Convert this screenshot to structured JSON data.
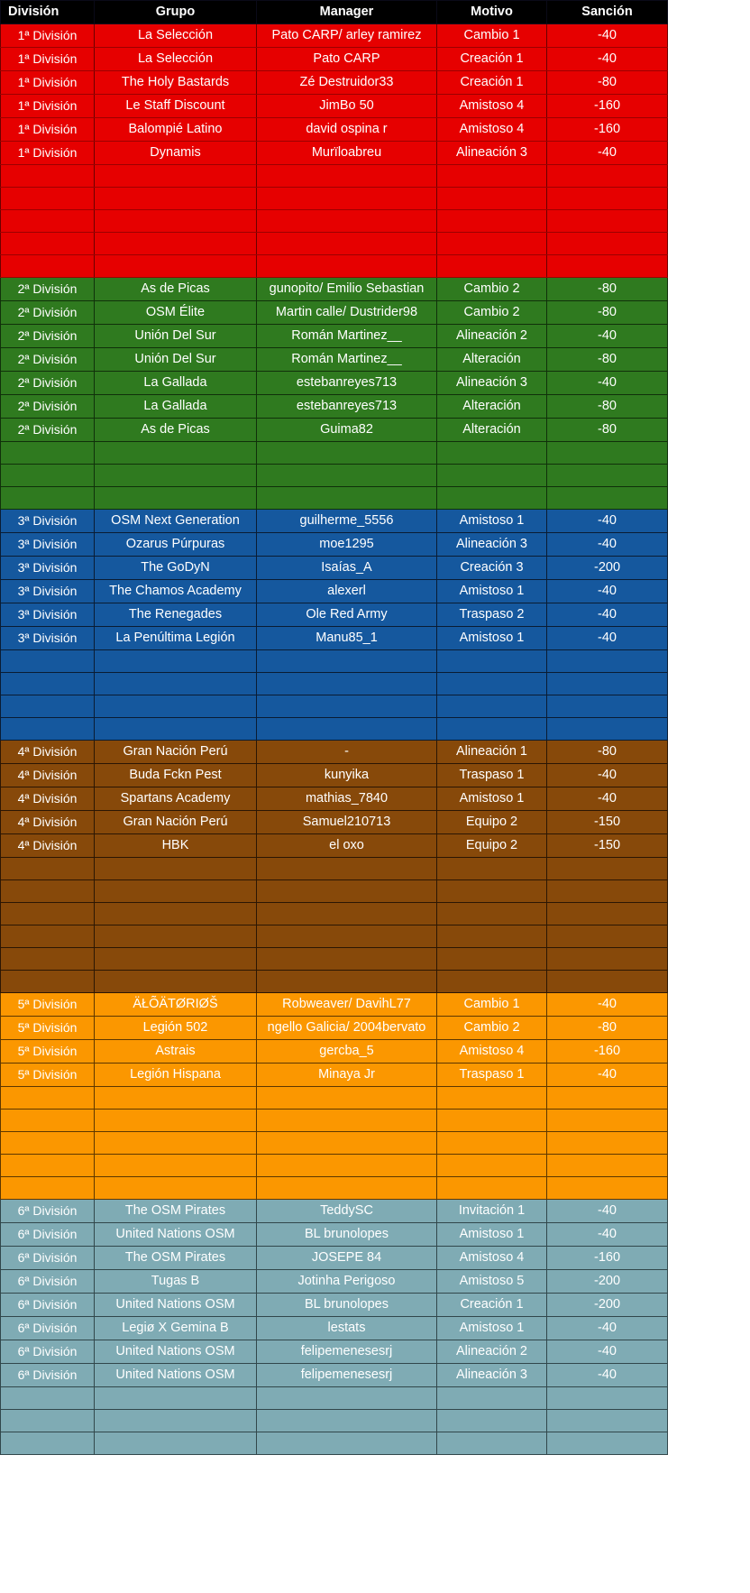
{
  "table": {
    "headers": {
      "division": "División",
      "grupo": "Grupo",
      "manager": "Manager",
      "motivo": "Motivo",
      "sancion": "Sanción"
    },
    "colors": {
      "header_bg": "#000000",
      "header_text": "#ffffff",
      "div1": "#e60000",
      "div2": "#2f7a1f",
      "div3": "#15589e",
      "div4": "#87490a",
      "div5": "#fb9700",
      "div6": "#7fabb4",
      "cell_text": "#ffffff",
      "gridline": "#0a0a18"
    },
    "sections": [
      {
        "key": "div1",
        "division": "1ª División",
        "rows": [
          {
            "division": "1ª División",
            "grupo": "La Selección",
            "manager": "Pato CARP/ arley ramirez",
            "motivo": "Cambio 1",
            "sancion": "-40"
          },
          {
            "division": "1ª División",
            "grupo": "La Selección",
            "manager": "Pato CARP",
            "motivo": "Creación 1",
            "sancion": "-40"
          },
          {
            "division": "1ª División",
            "grupo": "The Holy Bastards",
            "manager": "Zé Destruidor33",
            "motivo": "Creación 1",
            "sancion": "-80"
          },
          {
            "division": "1ª División",
            "grupo": "Le Staff Discount",
            "manager": "JimBo 50",
            "motivo": "Amistoso 4",
            "sancion": "-160"
          },
          {
            "division": "1ª División",
            "grupo": "Balompié Latino",
            "manager": "david ospina r",
            "motivo": "Amistoso 4",
            "sancion": "-160"
          },
          {
            "division": "1ª División",
            "grupo": "Dynamis",
            "manager": "Murïloabreu",
            "motivo": "Alineación 3",
            "sancion": "-40"
          },
          {
            "division": "",
            "grupo": "",
            "manager": "",
            "motivo": "",
            "sancion": ""
          },
          {
            "division": "",
            "grupo": "",
            "manager": "",
            "motivo": "",
            "sancion": ""
          },
          {
            "division": "",
            "grupo": "",
            "manager": "",
            "motivo": "",
            "sancion": ""
          },
          {
            "division": "",
            "grupo": "",
            "manager": "",
            "motivo": "",
            "sancion": ""
          },
          {
            "division": "",
            "grupo": "",
            "manager": "",
            "motivo": "",
            "sancion": ""
          }
        ]
      },
      {
        "key": "div2",
        "division": "2ª División",
        "rows": [
          {
            "division": "2ª División",
            "grupo": "As de Picas",
            "manager": "gunopito/ Emilio Sebastian",
            "motivo": "Cambio 2",
            "sancion": "-80"
          },
          {
            "division": "2ª División",
            "grupo": "OSM Élite",
            "manager": "Martin calle/ Dustrider98",
            "motivo": "Cambio 2",
            "sancion": "-80"
          },
          {
            "division": "2ª División",
            "grupo": "Unión Del Sur",
            "manager": "Román Martinez__",
            "motivo": "Alineación 2",
            "sancion": "-40"
          },
          {
            "division": "2ª División",
            "grupo": "Unión Del Sur",
            "manager": "Román Martinez__",
            "motivo": "Alteración",
            "sancion": "-80"
          },
          {
            "division": "2ª División",
            "grupo": "La Gallada",
            "manager": "estebanreyes713",
            "motivo": "Alineación 3",
            "sancion": "-40"
          },
          {
            "division": "2ª División",
            "grupo": "La Gallada",
            "manager": "estebanreyes713",
            "motivo": "Alteración",
            "sancion": "-80"
          },
          {
            "division": "2ª División",
            "grupo": "As de Picas",
            "manager": "Guima82",
            "motivo": "Alteración",
            "sancion": "-80"
          },
          {
            "division": "",
            "grupo": "",
            "manager": "",
            "motivo": "",
            "sancion": ""
          },
          {
            "division": "",
            "grupo": "",
            "manager": "",
            "motivo": "",
            "sancion": ""
          },
          {
            "division": "",
            "grupo": "",
            "manager": "",
            "motivo": "",
            "sancion": ""
          }
        ]
      },
      {
        "key": "div3",
        "division": "3ª División",
        "rows": [
          {
            "division": "3ª División",
            "grupo": "OSM Next Generation",
            "manager": "guilherme_5556",
            "motivo": "Amistoso 1",
            "sancion": "-40"
          },
          {
            "division": "3ª División",
            "grupo": "Ozarus Púrpuras",
            "manager": "moe1295",
            "motivo": "Alineación 3",
            "sancion": "-40"
          },
          {
            "division": "3ª División",
            "grupo": "The GoDyN",
            "manager": "Isaías_A",
            "motivo": "Creación 3",
            "sancion": "-200"
          },
          {
            "division": "3ª División",
            "grupo": "The Chamos Academy",
            "manager": "alexerl",
            "motivo": "Amistoso 1",
            "sancion": "-40"
          },
          {
            "division": "3ª División",
            "grupo": "The Renegades",
            "manager": "Ole Red Army",
            "motivo": "Traspaso 2",
            "sancion": "-40"
          },
          {
            "division": "3ª División",
            "grupo": "La Penúltima Legión",
            "manager": "Manu85_1",
            "motivo": "Amistoso 1",
            "sancion": "-40"
          },
          {
            "division": "",
            "grupo": "",
            "manager": "",
            "motivo": "",
            "sancion": ""
          },
          {
            "division": "",
            "grupo": "",
            "manager": "",
            "motivo": "",
            "sancion": ""
          },
          {
            "division": "",
            "grupo": "",
            "manager": "",
            "motivo": "",
            "sancion": ""
          },
          {
            "division": "",
            "grupo": "",
            "manager": "",
            "motivo": "",
            "sancion": ""
          }
        ]
      },
      {
        "key": "div4",
        "division": "4ª División",
        "rows": [
          {
            "division": "4ª División",
            "grupo": "Gran Nación Perú",
            "manager": "-",
            "motivo": "Alineación 1",
            "sancion": "-80"
          },
          {
            "division": "4ª División",
            "grupo": "Buda Fckn Pest",
            "manager": "kunyika",
            "motivo": "Traspaso 1",
            "sancion": "-40"
          },
          {
            "division": "4ª División",
            "grupo": "Spartans Academy",
            "manager": "mathias_7840",
            "motivo": "Amistoso 1",
            "sancion": "-40"
          },
          {
            "division": "4ª División",
            "grupo": "Gran Nación Perú",
            "manager": "Samuel210713",
            "motivo": "Equipo 2",
            "sancion": "-150"
          },
          {
            "division": "4ª División",
            "grupo": "HBK",
            "manager": "el oxo",
            "motivo": "Equipo 2",
            "sancion": "-150"
          },
          {
            "division": "",
            "grupo": "",
            "manager": "",
            "motivo": "",
            "sancion": ""
          },
          {
            "division": "",
            "grupo": "",
            "manager": "",
            "motivo": "",
            "sancion": ""
          },
          {
            "division": "",
            "grupo": "",
            "manager": "",
            "motivo": "",
            "sancion": ""
          },
          {
            "division": "",
            "grupo": "",
            "manager": "",
            "motivo": "",
            "sancion": ""
          },
          {
            "division": "",
            "grupo": "",
            "manager": "",
            "motivo": "",
            "sancion": ""
          },
          {
            "division": "",
            "grupo": "",
            "manager": "",
            "motivo": "",
            "sancion": ""
          }
        ]
      },
      {
        "key": "div5",
        "division": "5ª División",
        "rows": [
          {
            "division": "5ª División",
            "grupo": "ÄŁÕÄTØRIØŠ",
            "manager": "Robweaver/ DavihL77",
            "motivo": "Cambio 1",
            "sancion": "-40"
          },
          {
            "division": "5ª División",
            "grupo": "Legión 502",
            "manager": "ngello Galicia/ 2004bervato",
            "motivo": "Cambio 2",
            "sancion": "-80"
          },
          {
            "division": "5ª División",
            "grupo": "Astrais",
            "manager": "gercba_5",
            "motivo": "Amistoso 4",
            "sancion": "-160"
          },
          {
            "division": "5ª División",
            "grupo": "Legión Hispana",
            "manager": "Minaya Jr",
            "motivo": "Traspaso 1",
            "sancion": "-40"
          },
          {
            "division": "",
            "grupo": "",
            "manager": "",
            "motivo": "",
            "sancion": ""
          },
          {
            "division": "",
            "grupo": "",
            "manager": "",
            "motivo": "",
            "sancion": ""
          },
          {
            "division": "",
            "grupo": "",
            "manager": "",
            "motivo": "",
            "sancion": ""
          },
          {
            "division": "",
            "grupo": "",
            "manager": "",
            "motivo": "",
            "sancion": ""
          },
          {
            "division": "",
            "grupo": "",
            "manager": "",
            "motivo": "",
            "sancion": ""
          }
        ]
      },
      {
        "key": "div6",
        "division": "6ª División",
        "rows": [
          {
            "division": "6ª División",
            "grupo": "The OSM Pirates",
            "manager": "TeddySC",
            "motivo": "Invitación 1",
            "sancion": "-40"
          },
          {
            "division": "6ª División",
            "grupo": "United Nations OSM",
            "manager": "BL brunolopes",
            "motivo": "Amistoso 1",
            "sancion": "-40"
          },
          {
            "division": "6ª División",
            "grupo": "The OSM Pirates",
            "manager": "JOSEPE 84",
            "motivo": "Amistoso 4",
            "sancion": "-160"
          },
          {
            "division": "6ª División",
            "grupo": "Tugas B",
            "manager": "Jotinha Perigoso",
            "motivo": "Amistoso 5",
            "sancion": "-200"
          },
          {
            "division": "6ª División",
            "grupo": "United Nations OSM",
            "manager": "BL brunolopes",
            "motivo": "Creación 1",
            "sancion": "-200"
          },
          {
            "division": "6ª División",
            "grupo": "Legiø X Gemina B",
            "manager": "lestats",
            "motivo": "Amistoso 1",
            "sancion": "-40"
          },
          {
            "division": "6ª División",
            "grupo": "United Nations OSM",
            "manager": "felipemenesesrj",
            "motivo": "Alineación 2",
            "sancion": "-40"
          },
          {
            "division": "6ª División",
            "grupo": "United Nations OSM",
            "manager": "felipemenesesrj",
            "motivo": "Alineación 3",
            "sancion": "-40"
          },
          {
            "division": "",
            "grupo": "",
            "manager": "",
            "motivo": "",
            "sancion": ""
          },
          {
            "division": "",
            "grupo": "",
            "manager": "",
            "motivo": "",
            "sancion": ""
          },
          {
            "division": "",
            "grupo": "",
            "manager": "",
            "motivo": "",
            "sancion": ""
          }
        ]
      }
    ]
  }
}
